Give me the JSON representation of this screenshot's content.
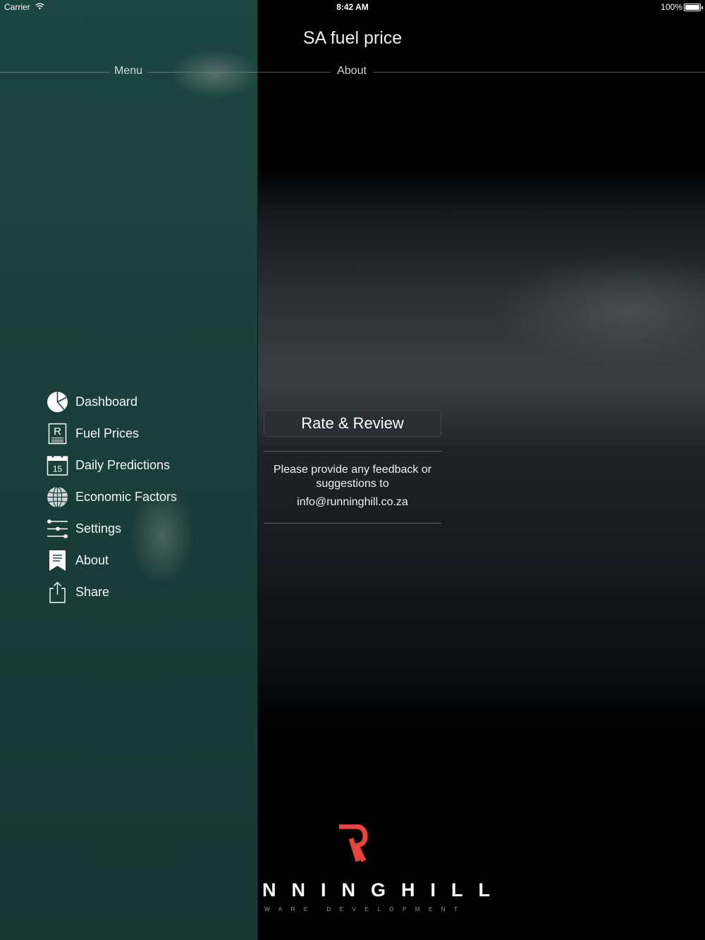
{
  "status_bar": {
    "carrier": "Carrier",
    "time": "8:42 AM",
    "battery": "100%"
  },
  "app": {
    "title": "SA fuel price"
  },
  "about_header": "About",
  "sidebar": {
    "title": "Menu",
    "items": [
      {
        "label": "Dashboard",
        "icon": "pie-chart-icon"
      },
      {
        "label": "Fuel Prices",
        "icon": "rand-document-icon"
      },
      {
        "label": "Daily Predictions",
        "icon": "calendar-icon",
        "icon_text": "15"
      },
      {
        "label": "Economic Factors",
        "icon": "globe-icon"
      },
      {
        "label": "Settings",
        "icon": "sliders-icon"
      },
      {
        "label": "About",
        "icon": "bookmark-icon"
      },
      {
        "label": "Share",
        "icon": "share-icon"
      }
    ],
    "accent_color": "#1a4541"
  },
  "about": {
    "rate_button": "Rate & Review",
    "feedback_text": "Please provide any feedback or suggestions to",
    "email": "info@runninghill.co.za"
  },
  "logo": {
    "mark": "R",
    "name": "NNINGHILL",
    "subtitle": "WARE DEVELOPMENT",
    "accent_color": "#e8463a"
  }
}
